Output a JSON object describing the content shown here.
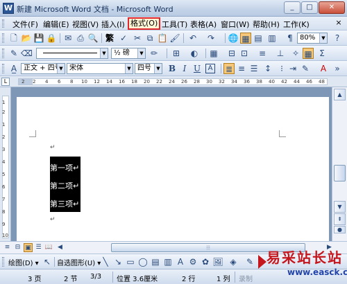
{
  "window": {
    "title": "新建 Microsoft Word 文档 - Microsoft Word",
    "controls": [
      "_",
      "□",
      "✕"
    ]
  },
  "menubar": {
    "items": [
      {
        "label": "文件(F)"
      },
      {
        "label": "编辑(E)"
      },
      {
        "label": "视图(V)"
      },
      {
        "label": "插入(I)"
      },
      {
        "label": "格式(O)",
        "highlighted": true
      },
      {
        "label": "工具(T)"
      },
      {
        "label": "表格(A)"
      },
      {
        "label": "窗口(W)"
      },
      {
        "label": "帮助(H)"
      },
      {
        "label": "工作(K)"
      }
    ],
    "close_glyph": "×"
  },
  "standard_toolbar": {
    "traditional_chinese": "繁",
    "zoom": "80%"
  },
  "drawing_line_toolbar": {
    "line_weight": "½ 磅"
  },
  "format_toolbar": {
    "style": "正文 + 四号",
    "font": "宋体",
    "size": "四号",
    "bold": "B",
    "italic": "I",
    "underline": "U",
    "char_border": "A",
    "font_color": "A"
  },
  "ruler": {
    "ticks": [
      "2",
      "2",
      "4",
      "6",
      "8",
      "10",
      "12",
      "14",
      "16",
      "18",
      "20",
      "22",
      "24",
      "26",
      "28",
      "30",
      "32",
      "34",
      "36",
      "38",
      "40",
      "42",
      "44",
      "46",
      "48"
    ]
  },
  "vruler": {
    "ticks": [
      "1",
      "2",
      "1",
      "2",
      "3",
      "4",
      "5",
      "6",
      "7",
      "8",
      "9",
      "10"
    ]
  },
  "document": {
    "lines": [
      "第一项↵",
      "第二项↵",
      "第三项↵"
    ],
    "para_mark": "↵"
  },
  "drawing_toolbar": {
    "draw_label": "绘图(D) ▾",
    "autoshape_label": "自选图形(U) ▾"
  },
  "statusbar": {
    "page": "3 页",
    "section": "2 节",
    "page_of": "3/3",
    "position": "位置 3.6厘米",
    "line": "2 行",
    "column": "1 列",
    "record": "录制"
  },
  "watermark": {
    "chinese": "易采站长站",
    "url": "www.easck.com"
  },
  "colors": {
    "highlight_border": "#e0262a",
    "selection_bg": "#000000",
    "doc_bg": "#7f97b7"
  }
}
